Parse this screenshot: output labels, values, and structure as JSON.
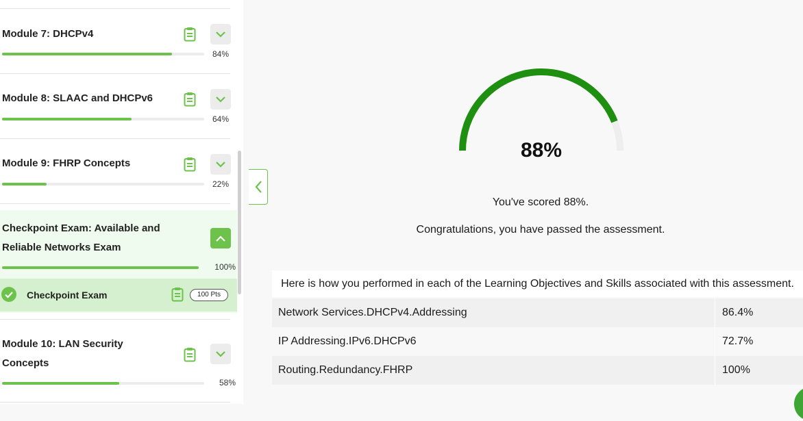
{
  "sidebar": {
    "modules": [
      {
        "title": "Module 7: DHCPv4",
        "progress": 84,
        "percent_label": "84%",
        "icon": "clipboard-icon",
        "chevron": "chevron-down-icon"
      },
      {
        "title": "Module 8: SLAAC and DHCPv6",
        "progress": 64,
        "percent_label": "64%",
        "icon": "clipboard-icon",
        "chevron": "chevron-down-icon"
      },
      {
        "title": "Module 9: FHRP Concepts",
        "progress": 22,
        "percent_label": "22%",
        "icon": "clipboard-icon",
        "chevron": "chevron-down-icon"
      }
    ],
    "checkpoint_section": {
      "title_line1": "Checkpoint Exam: Available and",
      "title_line2": "Reliable Networks Exam",
      "progress": 100,
      "percent_label": "100%",
      "chevron": "chevron-up-icon",
      "item": {
        "label": "Checkpoint Exam",
        "points": "100 Pts",
        "status_icon": "check-circle-icon",
        "icon": "clipboard-icon"
      }
    },
    "module10": {
      "title_line1": "Module 10: LAN Security",
      "title_line2": "Concepts",
      "progress": 58,
      "percent_label": "58%",
      "icon": "clipboard-icon",
      "chevron": "chevron-down-icon"
    }
  },
  "collapse_button": {
    "icon": "chevron-left-icon"
  },
  "result": {
    "score": 88,
    "score_label": "88%",
    "scored_text": "You've scored 88%.",
    "congrats_text": "Congratulations, you have passed the assessment."
  },
  "objectives": {
    "header": "Here is how you performed in each of the Learning Objectives and Skills associated with this assessment.",
    "rows": [
      {
        "name": "Network Services.DHCPv4.Addressing",
        "score": "86.4%"
      },
      {
        "name": "IP Addressing.IPv6.DHCPv6",
        "score": "72.7%"
      },
      {
        "name": "Routing.Redundancy.FHRP",
        "score": "100%"
      }
    ]
  },
  "colors": {
    "accent": "#6cc24a",
    "gauge": "#1f8f12",
    "gauge_track": "#eeeeee"
  }
}
